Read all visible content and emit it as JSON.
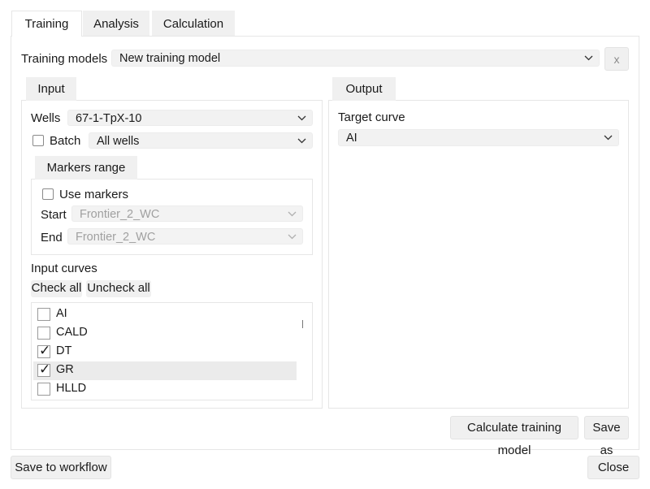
{
  "tabs": [
    "Training",
    "Analysis",
    "Calculation"
  ],
  "training_models": {
    "label": "Training models",
    "value": "New training model",
    "remove_label": "x"
  },
  "input": {
    "tab_label": "Input",
    "wells_label": "Wells",
    "wells_value": "67-1-TpX-10",
    "batch_label": "Batch",
    "batch_checked": false,
    "batch_value": "All wells",
    "markers_range_label": "Markers range",
    "use_markers_label": "Use markers",
    "use_markers_checked": false,
    "start_label": "Start",
    "start_value": "Frontier_2_WC",
    "end_label": "End",
    "end_value": "Frontier_2_WC",
    "input_curves_label": "Input curves",
    "check_all_label": "Check all",
    "uncheck_all_label": "Uncheck all",
    "curves": [
      {
        "name": "AI",
        "checked": false
      },
      {
        "name": "CALD",
        "checked": false
      },
      {
        "name": "DT",
        "checked": true
      },
      {
        "name": "GR",
        "checked": true
      },
      {
        "name": "HLLD",
        "checked": false
      }
    ]
  },
  "output": {
    "tab_label": "Output",
    "target_curve_label": "Target curve",
    "target_curve_value": "AI"
  },
  "actions": {
    "calculate_label": "Calculate training model",
    "save_as_label": "Save as",
    "save_to_workflow_label": "Save to workflow",
    "close_label": "Close"
  },
  "check_glyph": "✓"
}
